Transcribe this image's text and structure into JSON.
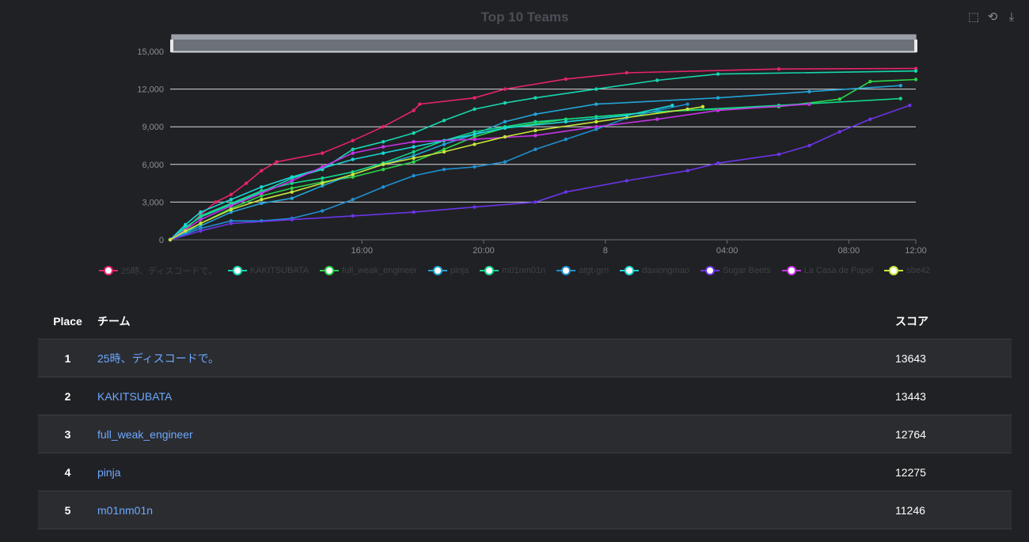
{
  "chart": {
    "title": "Top 10 Teams",
    "toolbox": [
      {
        "name": "zoom-icon",
        "glyph": "⬚"
      },
      {
        "name": "zoom-reset-icon",
        "glyph": "⟲"
      },
      {
        "name": "download-icon",
        "glyph": "⤓"
      }
    ]
  },
  "chart_data": {
    "type": "line",
    "title": "Top 10 Teams",
    "x_ticks": [
      "16:00",
      "20:00",
      "8",
      "04:00",
      "08:00",
      "12:00"
    ],
    "y_ticks": [
      "0",
      "3,000",
      "6,000",
      "9,000",
      "12,000",
      "15,000"
    ],
    "ylim": [
      0,
      15000
    ],
    "xlim_hours": [
      0,
      24.5
    ],
    "grid": true,
    "legend_position": "bottom",
    "series": [
      {
        "name": "25時、ディスコードで。",
        "color": "#e5246b",
        "points": [
          [
            0,
            0
          ],
          [
            0.5,
            800
          ],
          [
            1,
            2000
          ],
          [
            1.5,
            3000
          ],
          [
            2,
            3600
          ],
          [
            2.5,
            4500
          ],
          [
            3,
            5500
          ],
          [
            3.5,
            6200
          ],
          [
            5,
            6900
          ],
          [
            6,
            7900
          ],
          [
            7,
            9000
          ],
          [
            8,
            10300
          ],
          [
            8.2,
            10800
          ],
          [
            10,
            11300
          ],
          [
            11,
            12000
          ],
          [
            13,
            12800
          ],
          [
            15,
            13300
          ],
          [
            20,
            13600
          ],
          [
            24.5,
            13643
          ]
        ]
      },
      {
        "name": "KAKITSUBATA",
        "color": "#17d6b0",
        "points": [
          [
            0,
            0
          ],
          [
            0.5,
            1000
          ],
          [
            1,
            1800
          ],
          [
            2,
            2800
          ],
          [
            3,
            3800
          ],
          [
            4,
            4900
          ],
          [
            5,
            5600
          ],
          [
            6,
            7200
          ],
          [
            7,
            7800
          ],
          [
            8,
            8500
          ],
          [
            9,
            9500
          ],
          [
            10,
            10400
          ],
          [
            11,
            10900
          ],
          [
            12,
            11300
          ],
          [
            14,
            12000
          ],
          [
            16,
            12700
          ],
          [
            18,
            13200
          ],
          [
            24.5,
            13443
          ]
        ]
      },
      {
        "name": "full_weak_engineer",
        "color": "#2bd44a",
        "points": [
          [
            0,
            0
          ],
          [
            0.5,
            600
          ],
          [
            1,
            1300
          ],
          [
            2,
            2500
          ],
          [
            3,
            3500
          ],
          [
            4,
            4100
          ],
          [
            5,
            4600
          ],
          [
            6,
            5000
          ],
          [
            7,
            5600
          ],
          [
            8,
            6200
          ],
          [
            9,
            7200
          ],
          [
            10,
            8200
          ],
          [
            11,
            8900
          ],
          [
            13,
            9600
          ],
          [
            16,
            10200
          ],
          [
            20,
            10600
          ],
          [
            22,
            11200
          ],
          [
            23,
            12600
          ],
          [
            24.5,
            12764
          ]
        ]
      },
      {
        "name": "pinja",
        "color": "#22a4d6",
        "points": [
          [
            0,
            0
          ],
          [
            1,
            1100
          ],
          [
            2,
            2200
          ],
          [
            3,
            2900
          ],
          [
            4,
            3300
          ],
          [
            5,
            4300
          ],
          [
            6,
            5200
          ],
          [
            7,
            6000
          ],
          [
            8,
            6700
          ],
          [
            9,
            7600
          ],
          [
            10,
            8400
          ],
          [
            11,
            9400
          ],
          [
            12,
            10000
          ],
          [
            14,
            10800
          ],
          [
            18,
            11300
          ],
          [
            21,
            11800
          ],
          [
            24,
            12275
          ]
        ]
      },
      {
        "name": "m01nm01n",
        "color": "#13d68c",
        "points": [
          [
            0,
            0
          ],
          [
            0.5,
            900
          ],
          [
            1,
            1900
          ],
          [
            2,
            2900
          ],
          [
            3,
            3900
          ],
          [
            4,
            4500
          ],
          [
            5,
            4900
          ],
          [
            6,
            5400
          ],
          [
            7,
            6100
          ],
          [
            8,
            7000
          ],
          [
            9,
            7900
          ],
          [
            10,
            8600
          ],
          [
            11,
            9000
          ],
          [
            12,
            9400
          ],
          [
            14,
            9800
          ],
          [
            16,
            10200
          ],
          [
            20,
            10700
          ],
          [
            24,
            11246
          ]
        ]
      },
      {
        "name": "atgt-grn",
        "color": "#1f8fd0",
        "points": [
          [
            0,
            0
          ],
          [
            1,
            900
          ],
          [
            2,
            1500
          ],
          [
            3,
            1500
          ],
          [
            4,
            1700
          ],
          [
            5,
            2300
          ],
          [
            6,
            3200
          ],
          [
            7,
            4200
          ],
          [
            8,
            5100
          ],
          [
            9,
            5600
          ],
          [
            10,
            5800
          ],
          [
            11,
            6200
          ],
          [
            12,
            7200
          ],
          [
            13,
            8000
          ],
          [
            14,
            8800
          ],
          [
            15,
            9700
          ],
          [
            16,
            10300
          ],
          [
            17,
            10800
          ]
        ]
      },
      {
        "name": "daxiongmao",
        "color": "#19d6d6",
        "points": [
          [
            0,
            0
          ],
          [
            0.5,
            1200
          ],
          [
            1,
            2200
          ],
          [
            2,
            3200
          ],
          [
            3,
            4200
          ],
          [
            4,
            5000
          ],
          [
            5,
            5700
          ],
          [
            6,
            6400
          ],
          [
            7,
            6900
          ],
          [
            8,
            7400
          ],
          [
            9,
            7900
          ],
          [
            10,
            8400
          ],
          [
            11,
            8900
          ],
          [
            13,
            9400
          ],
          [
            15,
            9900
          ],
          [
            16.5,
            10700
          ]
        ]
      },
      {
        "name": "Sugar Beets",
        "color": "#6a35e8",
        "points": [
          [
            0,
            0
          ],
          [
            1,
            700
          ],
          [
            2,
            1300
          ],
          [
            4,
            1600
          ],
          [
            6,
            1900
          ],
          [
            8,
            2200
          ],
          [
            10,
            2600
          ],
          [
            12,
            3000
          ],
          [
            13,
            3800
          ],
          [
            15,
            4700
          ],
          [
            17,
            5500
          ],
          [
            18,
            6100
          ],
          [
            20,
            6800
          ],
          [
            21,
            7500
          ],
          [
            22,
            8600
          ],
          [
            23,
            9600
          ],
          [
            24.3,
            10700
          ]
        ]
      },
      {
        "name": "La Casa de Papel",
        "color": "#c632e8",
        "points": [
          [
            0,
            0
          ],
          [
            0.5,
            800
          ],
          [
            1,
            1600
          ],
          [
            2,
            2700
          ],
          [
            3,
            3700
          ],
          [
            4,
            4700
          ],
          [
            5,
            5800
          ],
          [
            6,
            6900
          ],
          [
            7,
            7400
          ],
          [
            8,
            7800
          ],
          [
            10,
            8000
          ],
          [
            12,
            8300
          ],
          [
            14,
            9000
          ],
          [
            16,
            9600
          ],
          [
            18,
            10300
          ],
          [
            21,
            10800
          ]
        ]
      },
      {
        "name": "sbe42",
        "color": "#c8e63a",
        "points": [
          [
            0,
            0
          ],
          [
            0.5,
            700
          ],
          [
            1,
            1300
          ],
          [
            2,
            2400
          ],
          [
            3,
            3200
          ],
          [
            4,
            3800
          ],
          [
            5,
            4500
          ],
          [
            6,
            5200
          ],
          [
            7,
            6000
          ],
          [
            8,
            6500
          ],
          [
            9,
            7000
          ],
          [
            10,
            7600
          ],
          [
            11,
            8200
          ],
          [
            12,
            8700
          ],
          [
            14,
            9400
          ],
          [
            17,
            10400
          ],
          [
            17.5,
            10600
          ]
        ]
      }
    ]
  },
  "table": {
    "headers": {
      "place": "Place",
      "team": "チーム",
      "score": "スコア"
    },
    "rows": [
      {
        "place": "1",
        "team": "25時、ディスコードで。",
        "score": "13643"
      },
      {
        "place": "2",
        "team": "KAKITSUBATA",
        "score": "13443"
      },
      {
        "place": "3",
        "team": "full_weak_engineer",
        "score": "12764"
      },
      {
        "place": "4",
        "team": "pinja",
        "score": "12275"
      },
      {
        "place": "5",
        "team": "m01nm01n",
        "score": "11246"
      }
    ]
  }
}
